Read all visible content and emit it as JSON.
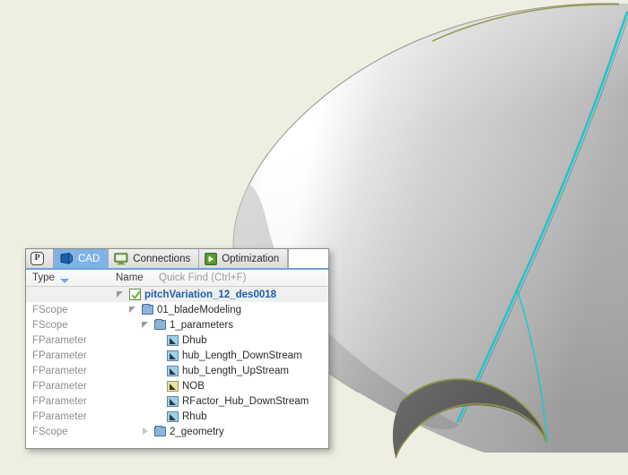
{
  "viewport": {
    "background_color": "#eeeee2",
    "object_name": "turbomachinery-blade-surface",
    "surface_color": "#c8c8c8",
    "highlight_color": "#ffffff",
    "edge_highlight_color": "#19c8d2",
    "section_edge_color": "#8f9243",
    "section_fill_color": "#5e5e5e"
  },
  "panel": {
    "tabs": [
      {
        "label": "",
        "icon": "p-logo-icon",
        "active": false
      },
      {
        "label": "CAD",
        "icon": "cad-shape-icon",
        "active": true
      },
      {
        "label": "Connections",
        "icon": "monitor-icon",
        "active": false
      },
      {
        "label": "Optimization",
        "icon": "play-square-icon",
        "active": false
      }
    ],
    "columns": {
      "type": "Type",
      "name": "Name",
      "quickfind_placeholder": "Quick Find (Ctrl+F)"
    },
    "tree": [
      {
        "type": "",
        "label": "pitchVariation_12_des0018",
        "icon": "green-check-icon",
        "indent": 0,
        "twisty": "open",
        "selected": true,
        "bold": true
      },
      {
        "type": "FScope",
        "label": "01_bladeModeling",
        "icon": "folder-icon",
        "indent": 1,
        "twisty": "open",
        "selected": false,
        "bold": false
      },
      {
        "type": "FScope",
        "label": "1_parameters",
        "icon": "folder-icon",
        "indent": 2,
        "twisty": "open",
        "selected": false,
        "bold": false
      },
      {
        "type": "FParameter",
        "label": "Dhub",
        "icon": "parameter-icon",
        "indent": 3,
        "twisty": "none",
        "selected": false,
        "bold": false
      },
      {
        "type": "FParameter",
        "label": "hub_Length_DownStream",
        "icon": "parameter-icon",
        "indent": 3,
        "twisty": "none",
        "selected": false,
        "bold": false
      },
      {
        "type": "FParameter",
        "label": "hub_Length_UpStream",
        "icon": "parameter-icon",
        "indent": 3,
        "twisty": "none",
        "selected": false,
        "bold": false
      },
      {
        "type": "FParameter",
        "label": "NOB",
        "icon": "parameter-icon-yellow",
        "indent": 3,
        "twisty": "none",
        "selected": false,
        "bold": false
      },
      {
        "type": "FParameter",
        "label": "RFactor_Hub_DownStream",
        "icon": "parameter-icon",
        "indent": 3,
        "twisty": "none",
        "selected": false,
        "bold": false
      },
      {
        "type": "FParameter",
        "label": "Rhub",
        "icon": "parameter-icon",
        "indent": 3,
        "twisty": "none",
        "selected": false,
        "bold": false
      },
      {
        "type": "FScope",
        "label": "2_geometry",
        "icon": "folder-icon",
        "indent": 2,
        "twisty": "closed",
        "selected": false,
        "bold": false
      }
    ]
  }
}
